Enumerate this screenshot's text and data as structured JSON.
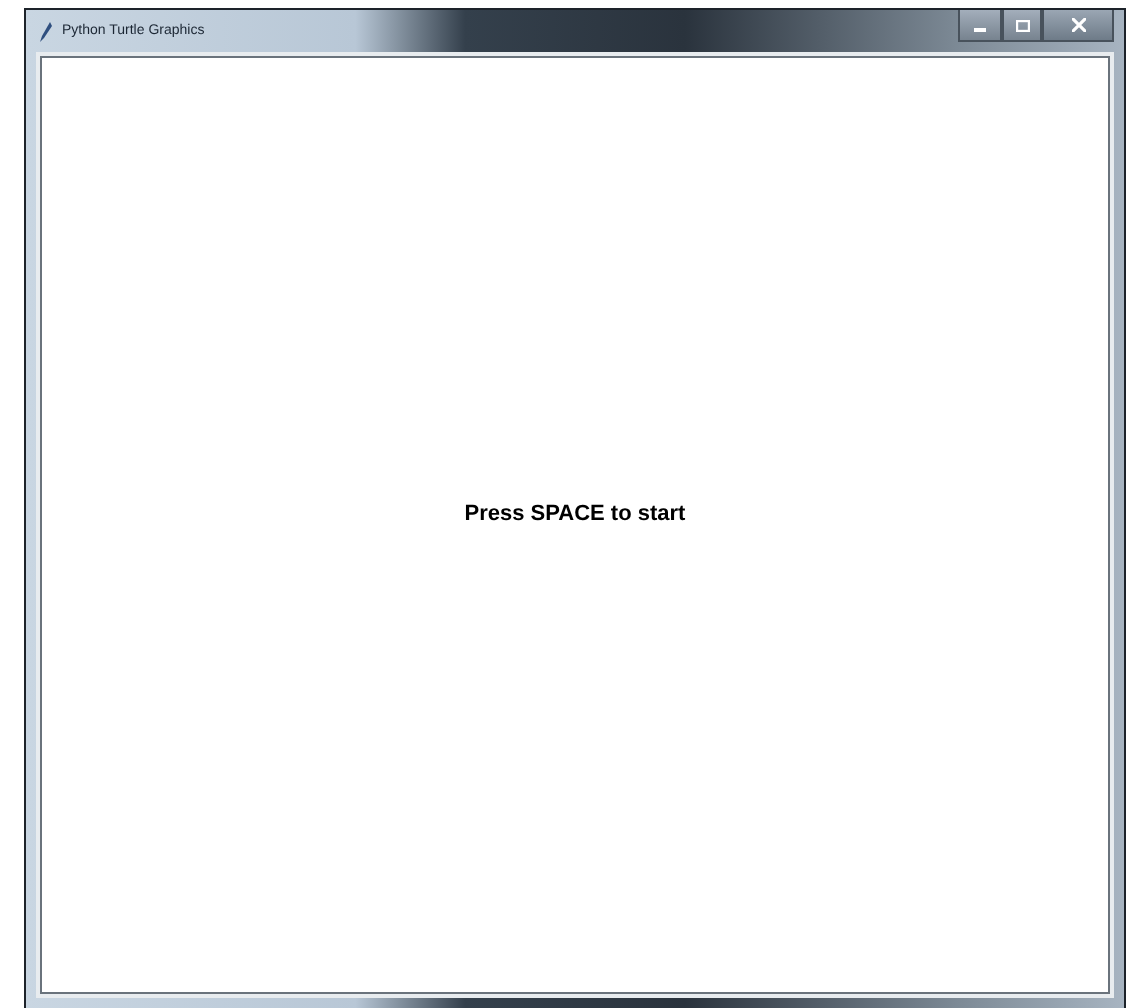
{
  "window": {
    "title": "Python Turtle Graphics"
  },
  "canvas": {
    "message": "Press SPACE to start"
  }
}
